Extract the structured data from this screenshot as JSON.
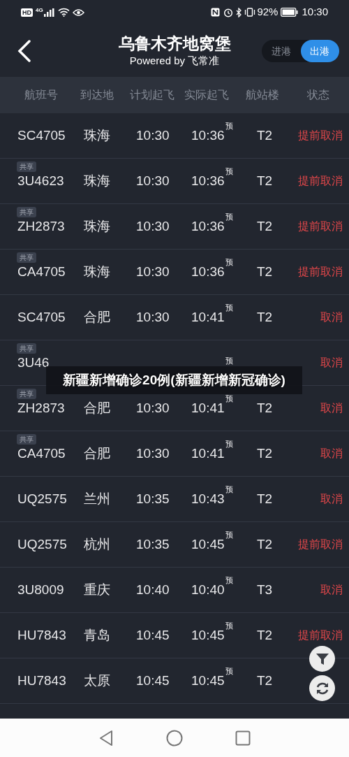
{
  "status_bar": {
    "left": [
      "HD",
      "4G"
    ],
    "battery": "92%",
    "time": "10:30"
  },
  "header": {
    "title": "乌鲁木齐地窝堡",
    "subtitle": "Powered by 飞常准",
    "toggle": [
      {
        "label": "进港",
        "selected": false
      },
      {
        "label": "出港",
        "selected": true
      }
    ]
  },
  "columns": [
    "航班号",
    "到达地",
    "计划起飞",
    "实际起飞",
    "航站楼",
    "状态"
  ],
  "rows": [
    {
      "shared": false,
      "flight": "SC4705",
      "destination": "珠海",
      "planned": "10:30",
      "actual": "10:36",
      "actual_mark": "预",
      "terminal": "T2",
      "status": "提前取消"
    },
    {
      "shared": true,
      "shared_label": "共享",
      "flight": "3U4623",
      "destination": "珠海",
      "planned": "10:30",
      "actual": "10:36",
      "actual_mark": "预",
      "terminal": "T2",
      "status": "提前取消"
    },
    {
      "shared": true,
      "shared_label": "共享",
      "flight": "ZH2873",
      "destination": "珠海",
      "planned": "10:30",
      "actual": "10:36",
      "actual_mark": "预",
      "terminal": "T2",
      "status": "提前取消"
    },
    {
      "shared": true,
      "shared_label": "共享",
      "flight": "CA4705",
      "destination": "珠海",
      "planned": "10:30",
      "actual": "10:36",
      "actual_mark": "预",
      "terminal": "T2",
      "status": "提前取消"
    },
    {
      "shared": false,
      "flight": "SC4705",
      "destination": "合肥",
      "planned": "10:30",
      "actual": "10:41",
      "actual_mark": "预",
      "terminal": "T2",
      "status": "取消"
    },
    {
      "shared": true,
      "shared_label": "共享",
      "flight": "3U46",
      "actual_mark": "预",
      "status": "取消"
    },
    {
      "shared": true,
      "shared_label": "共享",
      "flight": "ZH2873",
      "destination": "合肥",
      "planned": "10:30",
      "actual": "10:41",
      "actual_mark": "预",
      "terminal": "T2",
      "status": "取消"
    },
    {
      "shared": true,
      "shared_label": "共享",
      "flight": "CA4705",
      "destination": "合肥",
      "planned": "10:30",
      "actual": "10:41",
      "actual_mark": "预",
      "terminal": "T2",
      "status": "取消"
    },
    {
      "shared": false,
      "flight": "UQ2575",
      "destination": "兰州",
      "planned": "10:35",
      "actual": "10:43",
      "actual_mark": "预",
      "terminal": "T2",
      "status": "取消"
    },
    {
      "shared": false,
      "flight": "UQ2575",
      "destination": "杭州",
      "planned": "10:35",
      "actual": "10:45",
      "actual_mark": "预",
      "terminal": "T2",
      "status": "提前取消"
    },
    {
      "shared": false,
      "flight": "3U8009",
      "destination": "重庆",
      "planned": "10:40",
      "actual": "10:40",
      "actual_mark": "预",
      "terminal": "T3",
      "status": "取消"
    },
    {
      "shared": false,
      "flight": "HU7843",
      "destination": "青岛",
      "planned": "10:45",
      "actual": "10:45",
      "actual_mark": "预",
      "terminal": "T2",
      "status": "提前取消"
    },
    {
      "shared": false,
      "flight": "HU7843",
      "destination": "太原",
      "planned": "10:45",
      "actual": "10:45",
      "actual_mark": "预",
      "terminal": "T2"
    }
  ],
  "caption_overlay": "新疆新增确诊20例(新疆新增新冠确诊)"
}
